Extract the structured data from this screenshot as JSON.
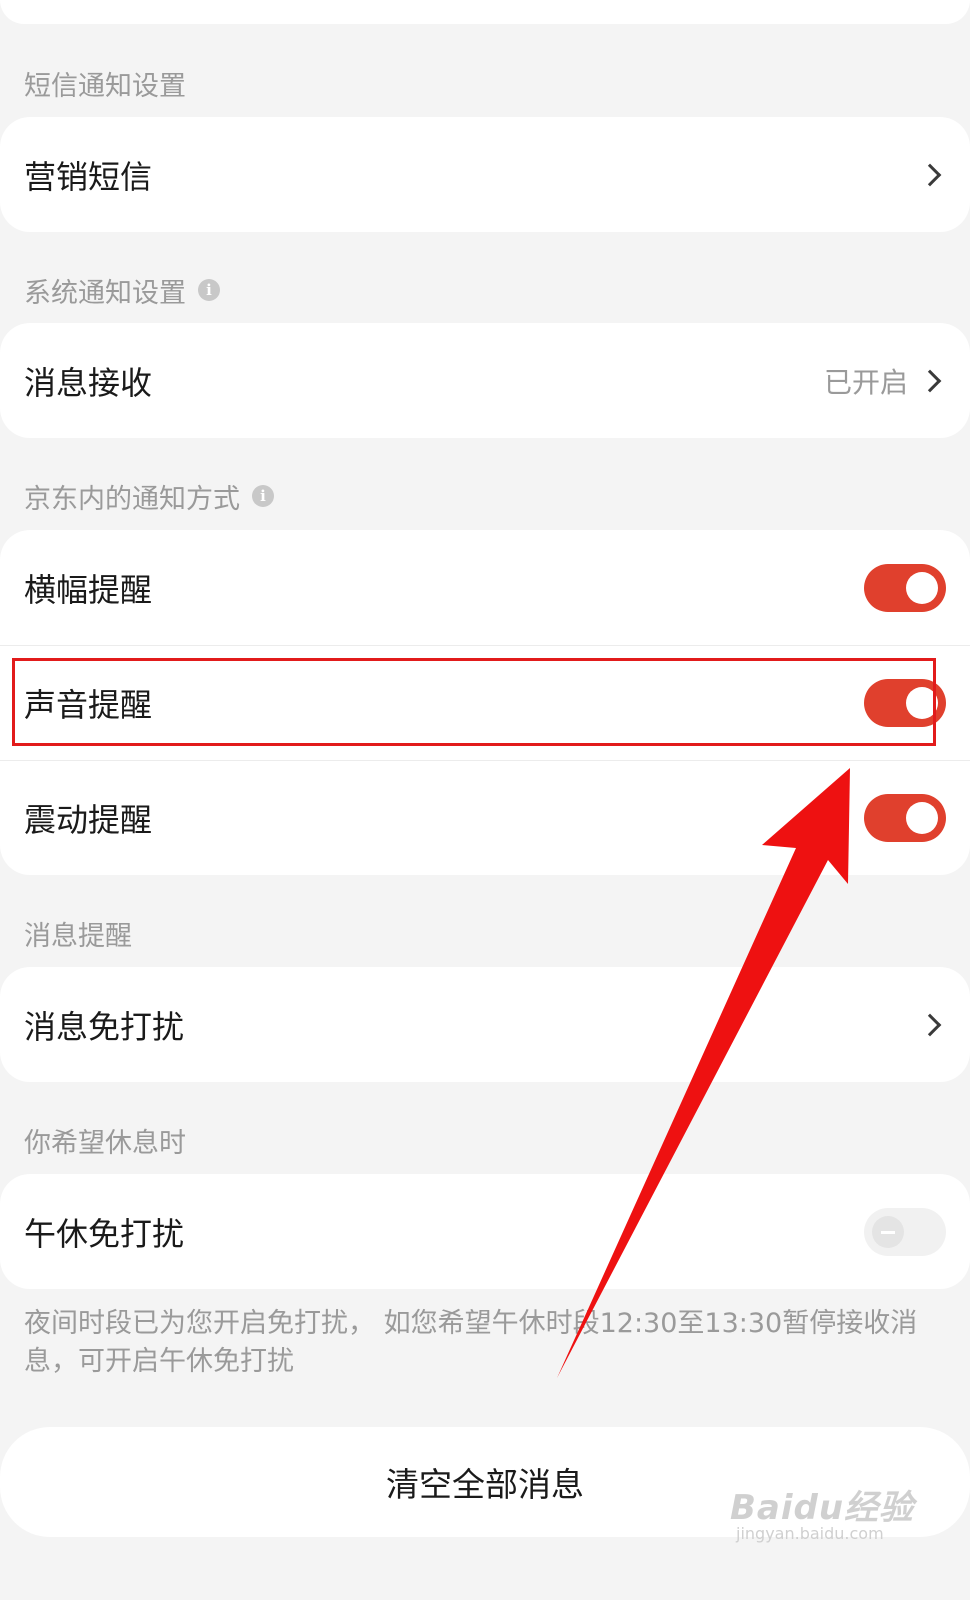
{
  "sections": {
    "sms": {
      "title": "短信通知设置",
      "marketing_sms": {
        "label": "营销短信"
      }
    },
    "system": {
      "title": "系统通知设置",
      "message_receive": {
        "label": "消息接收",
        "status": "已开启"
      }
    },
    "in_app": {
      "title": "京东内的通知方式",
      "banner": {
        "label": "横幅提醒",
        "enabled": true
      },
      "sound": {
        "label": "声音提醒",
        "enabled": true
      },
      "vibrate": {
        "label": "震动提醒",
        "enabled": true
      }
    },
    "reminder": {
      "title": "消息提醒",
      "dnd": {
        "label": "消息免打扰"
      }
    },
    "rest": {
      "title": "你希望休息时",
      "nap_dnd": {
        "label": "午休免打扰",
        "enabled": false
      },
      "note": "夜间时段已为您开启免打扰， 如您希望午休时段12:30至13:30暂停接收消息，可开启午休免打扰"
    }
  },
  "clear_all_label": "清空全部消息",
  "watermark": {
    "brand": "Baidu经验",
    "site": "jingyan.baidu.com"
  },
  "colors": {
    "toggle_on": "#e0402d",
    "annotation": "#e21b1b"
  }
}
